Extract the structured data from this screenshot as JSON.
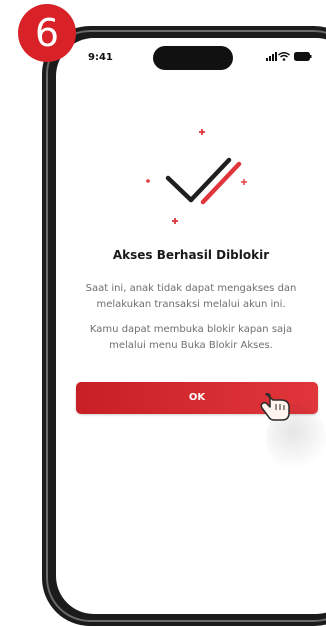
{
  "step": {
    "number": "6"
  },
  "status_bar": {
    "time": "9:41",
    "icons": [
      "signal-icon",
      "wifi-icon",
      "battery-icon"
    ]
  },
  "dialog": {
    "illustration": "checkmark-icon",
    "title": "Akses Berhasil Diblokir",
    "paragraph_1": "Saat ini, anak tidak dapat mengakses dan melakukan transaksi melalui akun ini.",
    "paragraph_2": "Kamu dapat membuka blokir kapan saja melalui menu Buka Blokir Akses.",
    "ok_label": "OK"
  },
  "cursor": {
    "icon": "hand-pointer-icon"
  },
  "colors": {
    "accent_red": "#d92128",
    "button_red": "#c81f26",
    "text_dark": "#1a1a1a",
    "text_gray": "#6f6f6f"
  }
}
